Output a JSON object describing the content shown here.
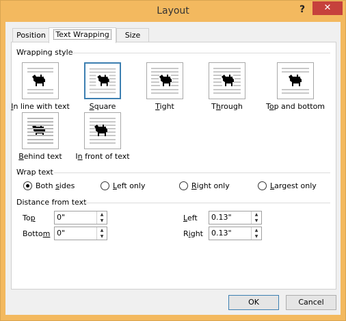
{
  "window": {
    "title": "Layout",
    "help": "?",
    "close": "✕"
  },
  "tabs": [
    {
      "label": "Position",
      "active": false
    },
    {
      "label": "Text Wrapping",
      "active": true
    },
    {
      "label": "Size",
      "active": false
    }
  ],
  "wrapping_style": {
    "label": "Wrapping style",
    "selected": "Square",
    "options": [
      {
        "label": "In line with text",
        "icon": "inline-wrap-icon"
      },
      {
        "label": "Square",
        "icon": "square-wrap-icon"
      },
      {
        "label": "Tight",
        "icon": "tight-wrap-icon"
      },
      {
        "label": "Through",
        "icon": "through-wrap-icon"
      },
      {
        "label": "Top and bottom",
        "icon": "top-bottom-wrap-icon"
      },
      {
        "label": "Behind text",
        "icon": "behind-text-wrap-icon"
      },
      {
        "label": "In front of text",
        "icon": "in-front-text-wrap-icon"
      }
    ]
  },
  "wrap_text": {
    "label": "Wrap text",
    "selected": "Both sides",
    "options": [
      "Both sides",
      "Left only",
      "Right only",
      "Largest only"
    ]
  },
  "distance": {
    "label": "Distance from text",
    "top": {
      "label": "Top",
      "value": "0\""
    },
    "bottom": {
      "label": "Bottom",
      "value": "0\""
    },
    "left": {
      "label": "Left",
      "value": "0.13\""
    },
    "right": {
      "label": "Right",
      "value": "0.13\""
    }
  },
  "buttons": {
    "ok": "OK",
    "cancel": "Cancel"
  },
  "colors": {
    "frame": "#f3b95f",
    "close": "#c6413c",
    "accent": "#3c7fb1"
  }
}
